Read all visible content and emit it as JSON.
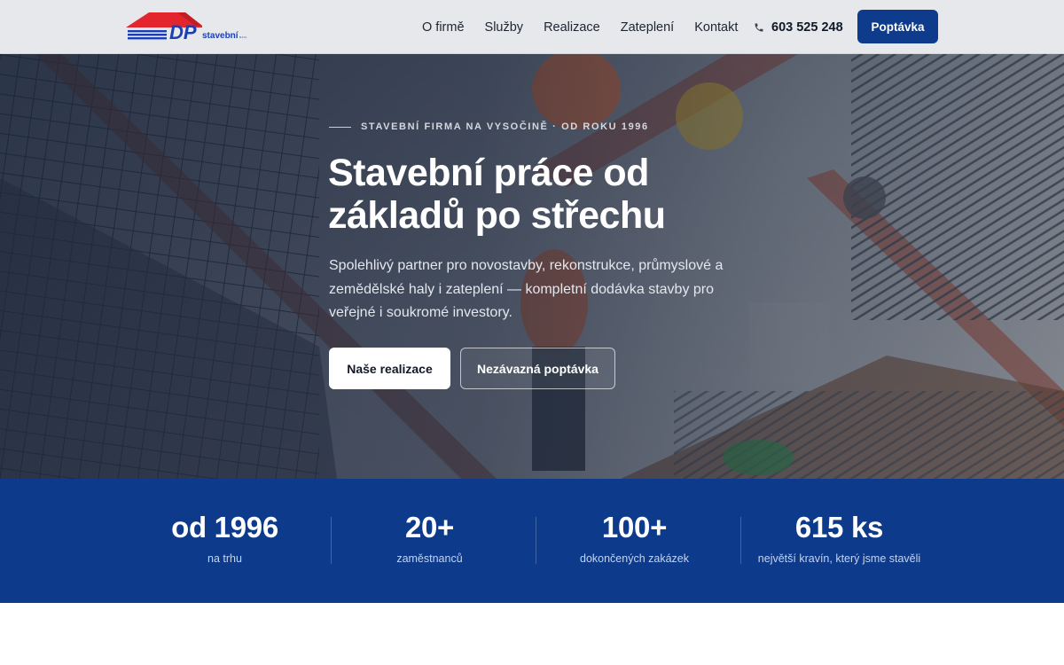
{
  "header": {
    "logo_text": "DP",
    "logo_subtext": "stavební",
    "logo_suffix": "s.r.o.",
    "nav": [
      {
        "label": "O firmě"
      },
      {
        "label": "Služby"
      },
      {
        "label": "Realizace"
      },
      {
        "label": "Zateplení"
      },
      {
        "label": "Kontakt"
      }
    ],
    "phone": "603 525 248",
    "cta_label": "Poptávka"
  },
  "hero": {
    "eyebrow": "STAVEBNÍ FIRMA NA VYSOČINĚ · OD ROKU 1996",
    "title_line1": "Stavební práce od",
    "title_line2": "základů po střechu",
    "text": "Spolehlivý partner pro novostavby, rekonstrukce, průmyslové a zemědělské haly i zateplení — kompletní dodávka stavby pro veřejné i soukromé investory.",
    "primary_button": "Naše realizace",
    "secondary_button": "Nezávazná poptávka"
  },
  "stats": [
    {
      "value": "od 1996",
      "label": "na trhu"
    },
    {
      "value": "20+",
      "label": "zaměstnanců"
    },
    {
      "value": "100+",
      "label": "dokončených zakázek"
    },
    {
      "value": "615 ks",
      "label": "největší kravín, který jsme stavěli"
    }
  ],
  "colors": {
    "brand_blue": "#0f3b8c",
    "stats_bg": "#0d3a8a",
    "logo_red": "#e3262d",
    "logo_blue": "#1d3fb4"
  }
}
